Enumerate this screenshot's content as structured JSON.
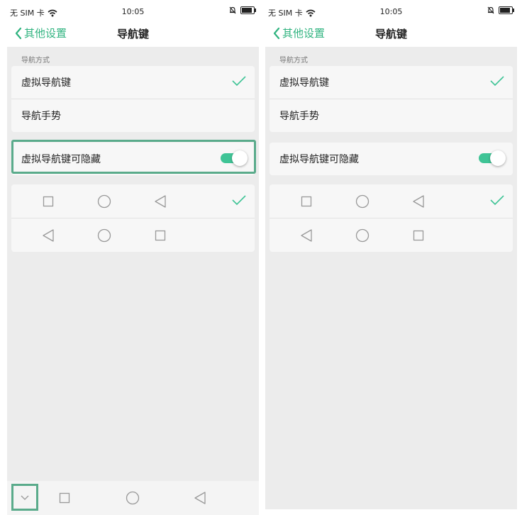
{
  "status_bar": {
    "carrier": "无 SIM 卡",
    "time": "10:05",
    "wifi_icon": "wifi-icon",
    "alarm_icon": "alarm-icon",
    "battery_icon": "battery-icon"
  },
  "title_bar": {
    "back_label": "其他设置",
    "title": "导航键"
  },
  "nav_section": {
    "label": "导航方式",
    "options": [
      {
        "label": "虚拟导航键",
        "selected": true
      },
      {
        "label": "导航手势",
        "selected": false
      }
    ]
  },
  "hide_toggle": {
    "label": "虚拟导航键可隐藏",
    "enabled": true
  },
  "layouts": [
    {
      "icons": [
        "square-icon",
        "circle-icon",
        "triangle-left-icon"
      ],
      "selected": true
    },
    {
      "icons": [
        "triangle-left-icon",
        "circle-icon",
        "square-icon"
      ],
      "selected": false
    }
  ],
  "bottom_nav_left": [
    "chevron-down-icon",
    "square-icon",
    "circle-icon",
    "triangle-left-icon"
  ],
  "colors": {
    "accent": "#2fb37f",
    "toggle_on": "#3fc496",
    "highlight": "#5aab8b",
    "background": "#ececec"
  }
}
